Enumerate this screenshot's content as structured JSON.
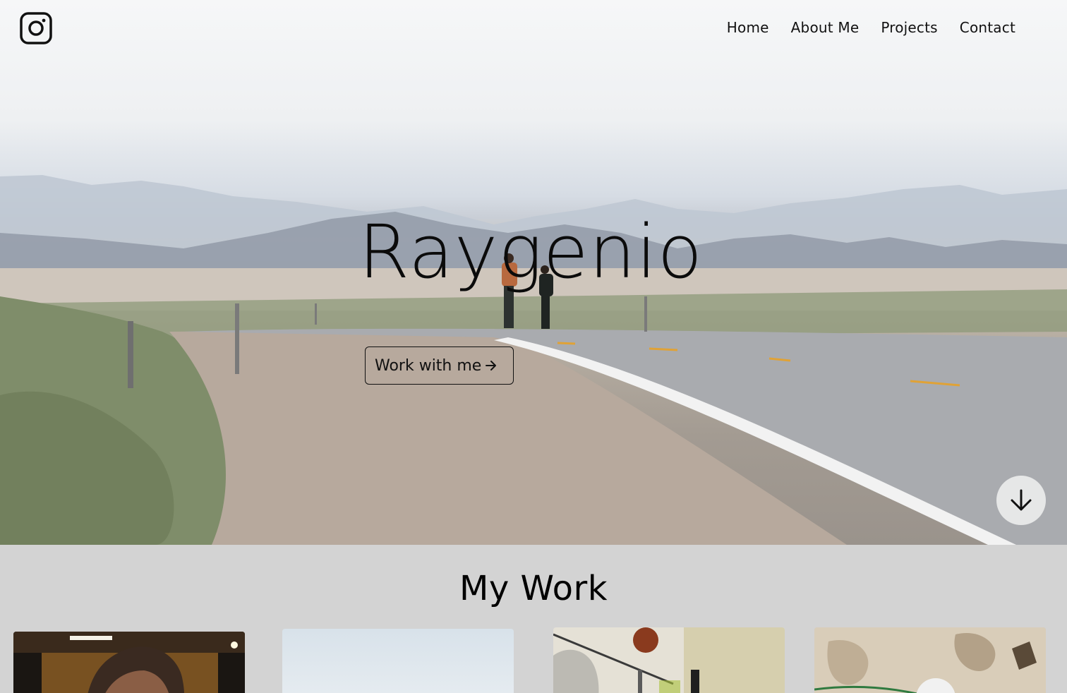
{
  "header": {
    "logo_icon": "instagram-icon",
    "nav": [
      {
        "label": "Home"
      },
      {
        "label": "About Me"
      },
      {
        "label": "Projects"
      },
      {
        "label": "Contact"
      }
    ]
  },
  "hero": {
    "title": "Raygenio",
    "cta_label": "Work with me",
    "cta_icon": "arrow-right-icon",
    "scroll_icon": "arrow-down-icon"
  },
  "work": {
    "title": "My Work",
    "projects": [
      {
        "image": "project-image-barber"
      },
      {
        "image": "project-image-sky"
      },
      {
        "image": "project-image-gym"
      },
      {
        "image": "project-image-climbing"
      }
    ]
  },
  "colors": {
    "text": "#111111",
    "section_bg": "#d3d3d3",
    "scroll_button_bg": "#ebebeb"
  }
}
